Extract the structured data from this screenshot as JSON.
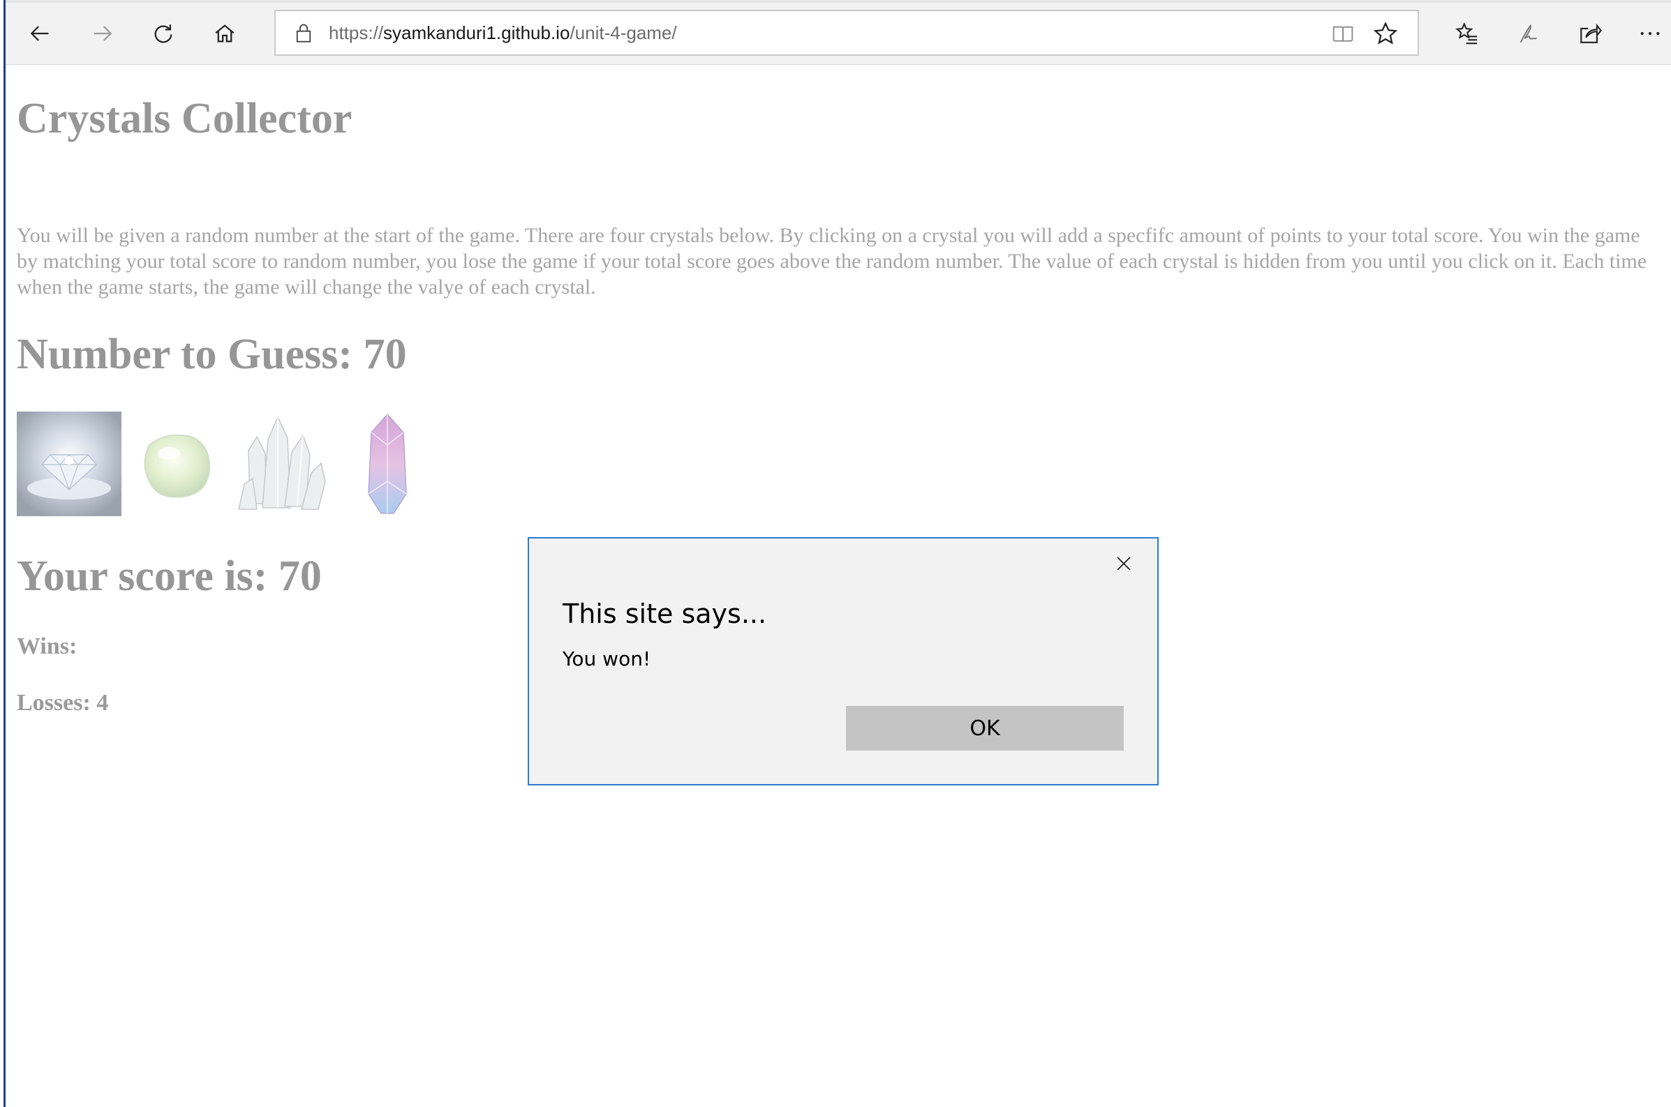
{
  "browser": {
    "url_scheme": "https://",
    "url_host": "syamkanduri1.github.io",
    "url_path": "/unit-4-game/",
    "icons": [
      "back-arrow-icon",
      "forward-arrow-icon",
      "refresh-icon",
      "home-icon",
      "lock-icon",
      "reading-view-icon",
      "favorite-star-icon",
      "favorites-list-icon",
      "pen-icon",
      "share-icon",
      "more-icon"
    ]
  },
  "page": {
    "title": "Crystals Collector",
    "intro": "You will be given a random number at the start of the game. There are four crystals below. By clicking on a crystal you will add a specfifc amount of points to your total score. You win the game by matching your total score to random number, you lose the game if your total score goes above the random number. The value of each crystal is hidden from you until you click on it. Each time when the game starts, the game will change the valye of each crystal.",
    "guess_label": "Number to Guess: 70",
    "score_label": "Your score is: 70",
    "wins_label": "Wins:",
    "losses_label": "Losses: 4",
    "crystals": [
      "diamond-crystal",
      "green-stone-crystal",
      "quartz-cluster-crystal",
      "purple-shard-crystal"
    ]
  },
  "dialog": {
    "title": "This site says...",
    "message": "You won!",
    "ok_label": "OK"
  },
  "colors": {
    "accent_blue": "#2a7bd0",
    "window_edge": "#1c3f94",
    "faded_text": "#969696"
  }
}
